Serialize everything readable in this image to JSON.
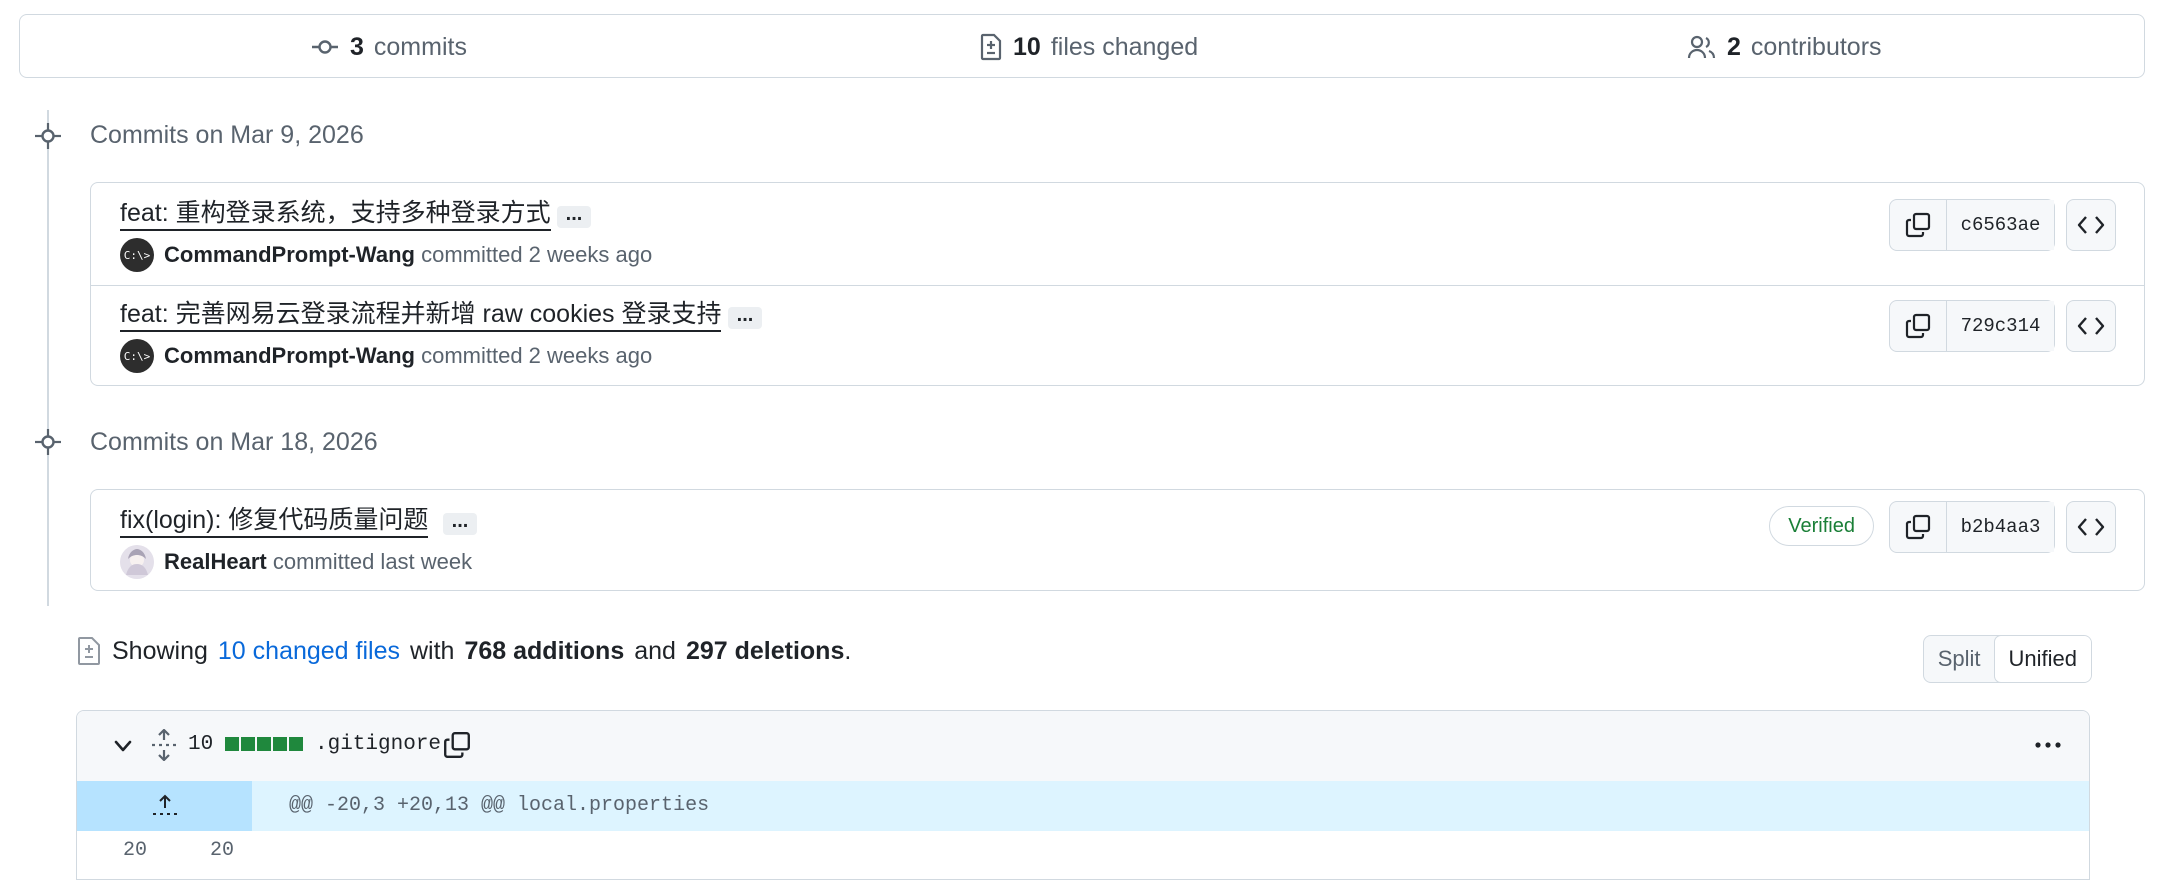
{
  "summary": {
    "commits_count": "3",
    "commits_label": "commits",
    "files_count": "10",
    "files_label": "files changed",
    "contributors_count": "2",
    "contributors_label": "contributors"
  },
  "groups": [
    {
      "title": "Commits on Mar 9, 2026",
      "commits": [
        {
          "message": "feat: 重构登录系统，支持多种登录方式",
          "author": "CommandPrompt-Wang",
          "meta": "committed 2 weeks ago",
          "sha": "c6563ae",
          "avatar_text": "C:\\>"
        },
        {
          "message": "feat: 完善网易云登录流程并新增 raw cookies 登录支持",
          "author": "CommandPrompt-Wang",
          "meta": "committed 2 weeks ago",
          "sha": "729c314",
          "avatar_text": "C:\\>"
        }
      ]
    },
    {
      "title": "Commits on Mar 18, 2026",
      "commits": [
        {
          "message": "fix(login): 修复代码质量问题",
          "author": "RealHeart",
          "meta": "committed last week",
          "sha": "b2b4aa3",
          "verified": "Verified"
        }
      ]
    }
  ],
  "ellipsis": "...",
  "showing": {
    "prefix": "Showing",
    "link": "10 changed files",
    "with": "with",
    "additions": "768 additions",
    "and": "and",
    "deletions": "297 deletions",
    "suffix": "."
  },
  "view_toggle": {
    "split": "Split",
    "unified": "Unified",
    "selected": "Unified"
  },
  "file": {
    "changes": "10",
    "name": ".gitignore",
    "hunk": "@@ -20,3 +20,13 @@ local.properties",
    "old_line": "20",
    "new_line": "20"
  },
  "colors": {
    "verified": "#1a7f37",
    "link": "#0969da",
    "addition": "#1f883d",
    "hunk_bg": "#ddf4ff"
  }
}
